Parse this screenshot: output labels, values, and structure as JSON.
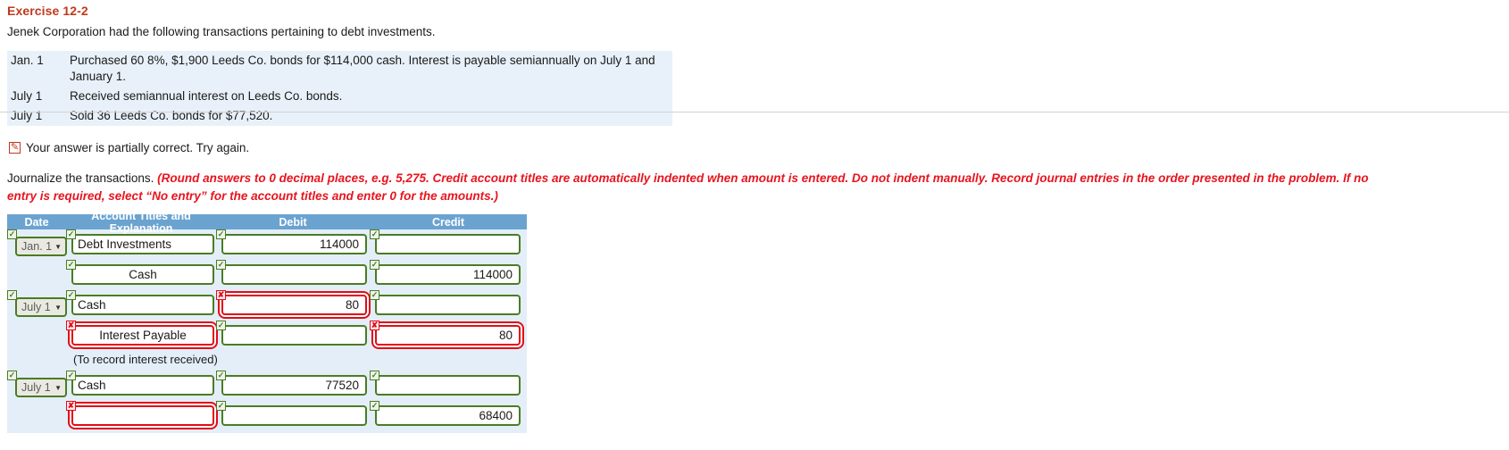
{
  "exercise": {
    "title": "Exercise 12-2",
    "intro": "Jenek Corporation had the following transactions pertaining to debt investments.",
    "facts": [
      {
        "date": "Jan. 1",
        "desc": "Purchased 60 8%, $1,900 Leeds Co. bonds for $114,000 cash. Interest is payable semiannually on July 1 and January 1."
      },
      {
        "date": "July 1",
        "desc": "Received semiannual interest on Leeds Co. bonds."
      },
      {
        "date": "July 1",
        "desc": "Sold 36 Leeds Co. bonds for $77,520."
      }
    ]
  },
  "feedback": {
    "icon": "pencil-icon",
    "text": "Your answer is partially correct.  Try again."
  },
  "instructions": {
    "lead": "Journalize the transactions. ",
    "emphasis": "(Round answers to 0 decimal places, e.g. 5,275. Credit account titles are automatically indented when amount is entered. Do not indent manually. Record journal entries in the order presented in the problem. If no entry is required, select “No entry” for the account titles and enter 0 for the amounts.)"
  },
  "journal": {
    "headers": {
      "date": "Date",
      "account": "Account Titles and Explanation",
      "debit": "Debit",
      "credit": "Credit"
    },
    "caret": "▼",
    "check_glyph": "✓",
    "cross_glyph": "✘",
    "colors": {
      "header_bg": "#6ba3d0",
      "body_bg": "#e4eef8",
      "ok": "#4a7c24",
      "error": "#e00d18",
      "accent_red": "#e8141e",
      "title_red": "#c0391b"
    },
    "rows": [
      {
        "date": "Jan. 1",
        "date_state": "ok",
        "account": "Debt Investments",
        "account_state": "ok",
        "account_indent": false,
        "debit": "114000",
        "debit_state": "ok",
        "credit": "",
        "credit_state": "ok"
      },
      {
        "date": "",
        "date_state": "none",
        "account": "Cash",
        "account_state": "ok",
        "account_indent": true,
        "debit": "",
        "debit_state": "ok",
        "credit": "114000",
        "credit_state": "ok"
      },
      {
        "date": "July 1",
        "date_state": "ok",
        "account": "Cash",
        "account_state": "ok",
        "account_indent": false,
        "debit": "80",
        "debit_state": "bad",
        "credit": "",
        "credit_state": "ok"
      },
      {
        "date": "",
        "date_state": "none",
        "account": "Interest Payable",
        "account_state": "bad",
        "account_indent": true,
        "debit": "",
        "debit_state": "ok",
        "credit": "80",
        "credit_state": "bad"
      },
      {
        "memo": "(To record interest received)"
      },
      {
        "date": "July 1",
        "date_state": "ok",
        "account": "Cash",
        "account_state": "ok",
        "account_indent": false,
        "debit": "77520",
        "debit_state": "ok",
        "credit": "",
        "credit_state": "ok"
      },
      {
        "date": "",
        "date_state": "none",
        "account": "",
        "account_state": "bad",
        "account_indent": true,
        "debit": "",
        "debit_state": "ok",
        "credit": "68400",
        "credit_state": "ok"
      }
    ]
  }
}
